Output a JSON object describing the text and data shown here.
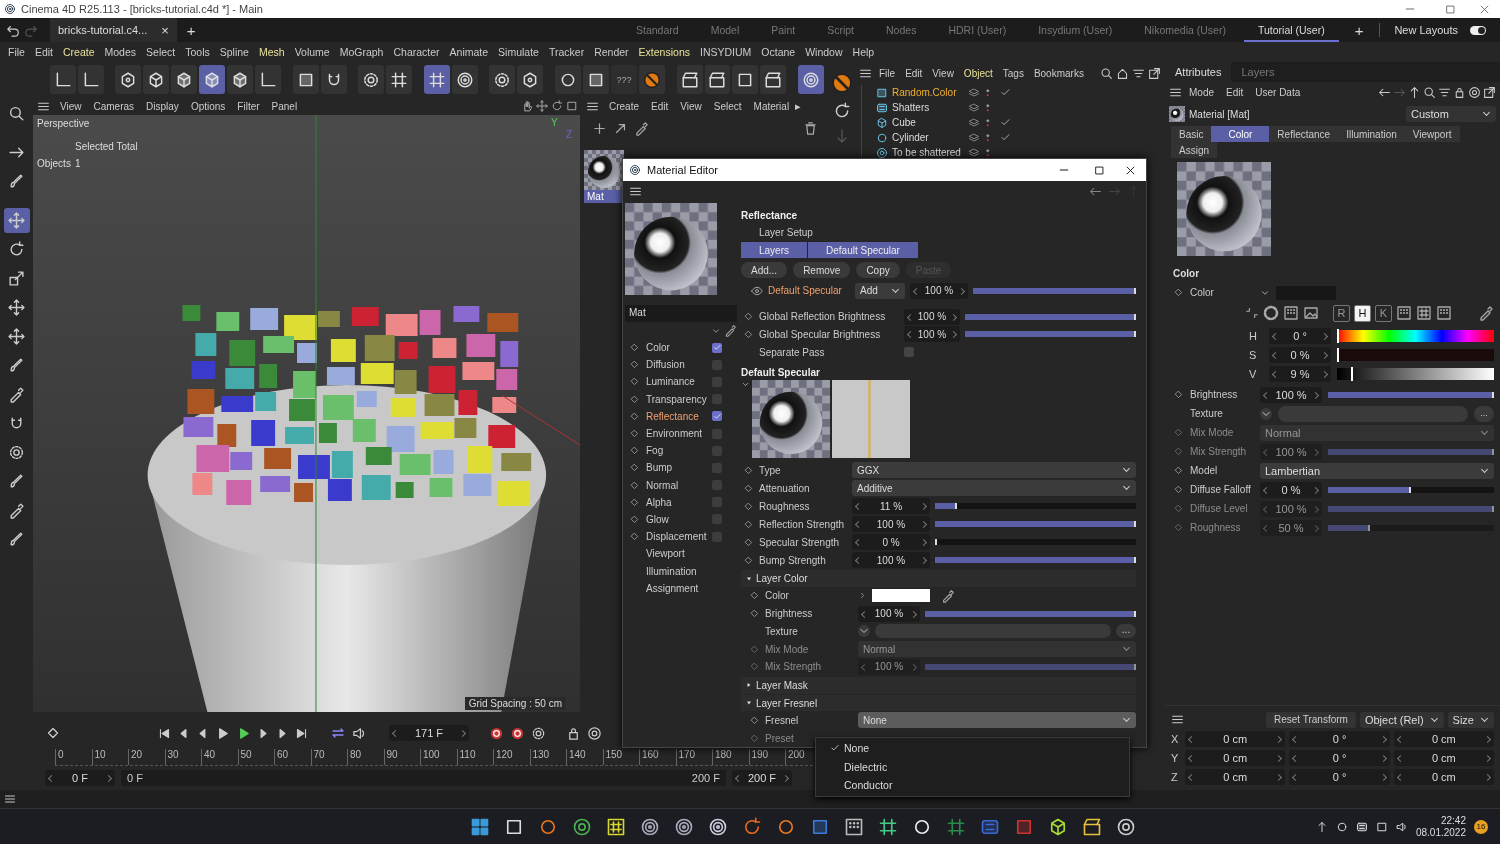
{
  "window": {
    "title": "Cinema 4D R25.113 - [bricks-tutorial.c4d *] - Main"
  },
  "document_tab": {
    "label": "bricks-tutorial.c4...",
    "close": "×"
  },
  "new_document": "+",
  "layouts": [
    {
      "label": "Standard",
      "selected": false
    },
    {
      "label": "Model",
      "selected": false
    },
    {
      "label": "Paint",
      "selected": false
    },
    {
      "label": "Script",
      "selected": false
    },
    {
      "label": "Nodes",
      "selected": false
    },
    {
      "label": "HDRI (User)",
      "selected": false
    },
    {
      "label": "Insydium (User)",
      "selected": false
    },
    {
      "label": "Nikomedia (User)",
      "selected": false
    },
    {
      "label": "Tutorial (User)",
      "selected": true
    }
  ],
  "add_layout": "+",
  "new_layouts": {
    "label": "New Layouts",
    "on": true
  },
  "menu": [
    {
      "label": "File",
      "highlighted": false
    },
    {
      "label": "Edit",
      "highlighted": false
    },
    {
      "label": "Create",
      "highlighted": true
    },
    {
      "label": "Modes",
      "highlighted": false
    },
    {
      "label": "Select",
      "highlighted": false
    },
    {
      "label": "Tools",
      "highlighted": false
    },
    {
      "label": "Spline",
      "highlighted": false
    },
    {
      "label": "Mesh",
      "highlighted": true
    },
    {
      "label": "Volume",
      "highlighted": false
    },
    {
      "label": "MoGraph",
      "highlighted": false
    },
    {
      "label": "Character",
      "highlighted": false
    },
    {
      "label": "Animate",
      "highlighted": false
    },
    {
      "label": "Simulate",
      "highlighted": false
    },
    {
      "label": "Tracker",
      "highlighted": false
    },
    {
      "label": "Render",
      "highlighted": false
    },
    {
      "label": "Extensions",
      "highlighted": true
    },
    {
      "label": "INSYDIUM",
      "highlighted": false
    },
    {
      "label": "Octane",
      "highlighted": false
    },
    {
      "label": "Window",
      "highlighted": false
    },
    {
      "label": "Help",
      "highlighted": false
    }
  ],
  "toolbar": {
    "tools": [
      {
        "active": false
      },
      {
        "active": false
      },
      {
        "active": false
      },
      {
        "active": false
      },
      {
        "active": false
      },
      {
        "active": true
      },
      {
        "active": false
      },
      {
        "active": false
      },
      {
        "active": false
      },
      {
        "active": false
      },
      {
        "active": false
      },
      {
        "active": false
      },
      {
        "active": true
      },
      {
        "active": false
      },
      {
        "active": false
      },
      {
        "active": false
      },
      {
        "active": false
      },
      {
        "active": false
      },
      {
        "active": false
      },
      {
        "active": false
      },
      {
        "active": false
      },
      {
        "active": false
      },
      {
        "active": false
      },
      {
        "active": true
      }
    ],
    "unknown_tool": "???"
  },
  "side_tools": [
    {
      "active": false
    },
    {
      "active": false
    },
    {
      "active": false
    },
    {
      "active": true
    },
    {
      "active": false
    },
    {
      "active": false
    },
    {
      "active": false
    },
    {
      "active": false
    },
    {
      "active": false
    },
    {
      "active": false
    },
    {
      "active": false
    },
    {
      "active": false
    },
    {
      "active": false
    },
    {
      "active": false
    },
    {
      "active": false
    }
  ],
  "viewport": {
    "menu": [
      "View",
      "Cameras",
      "Display",
      "Options",
      "Filter",
      "Panel"
    ],
    "camera": "Perspective",
    "hud_heading": "Selected Total",
    "hud_label": "Objects",
    "hud_value": "1",
    "axes": [
      "Y",
      "Z"
    ],
    "grid_spacing": "Grid Spacing : 50 cm"
  },
  "material_manager": {
    "menu": [
      "Create",
      "Edit",
      "View",
      "Select",
      "Material"
    ],
    "more": "▸",
    "materials": [
      {
        "name": "Mat",
        "selected": true
      }
    ]
  },
  "object_manager": {
    "menu": [
      {
        "label": "File",
        "highlighted": false
      },
      {
        "label": "Edit",
        "highlighted": false
      },
      {
        "label": "View",
        "highlighted": false
      },
      {
        "label": "Object",
        "highlighted": true
      },
      {
        "label": "Tags",
        "highlighted": false
      },
      {
        "label": "Bookmarks",
        "highlighted": false
      }
    ],
    "objects": [
      {
        "name": "Random.Color",
        "selected": true,
        "enabled": true
      },
      {
        "name": "Shatters",
        "selected": false,
        "enabled": false
      },
      {
        "name": "Cube",
        "selected": false,
        "enabled": true
      },
      {
        "name": "Cylinder",
        "selected": false,
        "enabled": true
      },
      {
        "name": "To be shattered",
        "selected": false,
        "enabled": false
      }
    ]
  },
  "attributes": {
    "tabs": [
      {
        "label": "Attributes",
        "selected": true
      },
      {
        "label": "Layers",
        "selected": false
      }
    ],
    "menu": [
      "Mode",
      "Edit",
      "User Data"
    ],
    "object": "Material [Mat]",
    "preset": "Custom",
    "sections": [
      {
        "label": "Basic",
        "selected": false
      },
      {
        "label": "Color",
        "selected": true
      },
      {
        "label": "Reflectance",
        "selected": false
      },
      {
        "label": "Illumination",
        "selected": false
      },
      {
        "label": "Viewport",
        "selected": false
      },
      {
        "label": "Assign",
        "selected": false
      }
    ],
    "heading": "Color",
    "color_label": "Color",
    "color_modes": [
      {
        "label": "R",
        "selected": false
      },
      {
        "label": "H",
        "selected": true
      },
      {
        "label": "K",
        "selected": false
      }
    ],
    "hsv": [
      {
        "label": "H",
        "value": "0 °",
        "level": 0
      },
      {
        "label": "S",
        "value": "0 %",
        "level": 0
      },
      {
        "label": "V",
        "value": "9 %",
        "level": 0.09
      }
    ],
    "params": [
      {
        "kind": "slider",
        "label": "Brightness",
        "value": "100 %",
        "level": 1,
        "disabled": false
      },
      {
        "kind": "texture",
        "label": "Texture",
        "more": "...",
        "disabled": false
      },
      {
        "kind": "dropdown",
        "label": "Mix Mode",
        "value": "Normal",
        "disabled": true
      },
      {
        "kind": "slider",
        "label": "Mix Strength",
        "value": "100 %",
        "level": 1,
        "disabled": true
      },
      {
        "kind": "dropdown",
        "label": "Model",
        "value": "Lambertian",
        "disabled": false
      },
      {
        "kind": "slider",
        "label": "Diffuse Falloff",
        "value": "0 %",
        "level": 0.5,
        "disabled": false
      },
      {
        "kind": "slider",
        "label": "Diffuse Level",
        "value": "100 %",
        "level": 1,
        "disabled": true
      },
      {
        "kind": "slider",
        "label": "Roughness",
        "value": "50 %",
        "level": 0.25,
        "disabled": true
      }
    ]
  },
  "coordinates": {
    "reset": "Reset Transform",
    "dropdowns": [
      "Object (Rel)",
      "Size"
    ],
    "rows": [
      {
        "axis": "X",
        "values": [
          "0 cm",
          "0 °",
          "0 cm"
        ]
      },
      {
        "axis": "Y",
        "values": [
          "0 cm",
          "0 °",
          "0 cm"
        ]
      },
      {
        "axis": "Z",
        "values": [
          "0 cm",
          "0 °",
          "0 cm"
        ]
      }
    ]
  },
  "timeline": {
    "current_frame": "171 F",
    "ruler": [
      "0",
      "10",
      "20",
      "30",
      "40",
      "50",
      "60",
      "70",
      "80",
      "90",
      "100",
      "110",
      "120",
      "130",
      "140",
      "150",
      "160",
      "170",
      "180",
      "190",
      "200"
    ],
    "start": "0 F",
    "range_start": "0 F",
    "range_end": "200 F",
    "end": "200 F"
  },
  "material_editor": {
    "title": "Material Editor",
    "name": "Mat",
    "channels": [
      {
        "label": "Color",
        "kind": "channel",
        "checked": true,
        "selected": false
      },
      {
        "label": "Diffusion",
        "kind": "channel",
        "checked": false,
        "selected": false
      },
      {
        "label": "Luminance",
        "kind": "channel",
        "checked": false,
        "selected": false
      },
      {
        "label": "Transparency",
        "kind": "channel",
        "checked": false,
        "selected": false
      },
      {
        "label": "Reflectance",
        "kind": "channel",
        "checked": true,
        "selected": true
      },
      {
        "label": "Environment",
        "kind": "channel",
        "checked": false,
        "selected": false
      },
      {
        "label": "Fog",
        "kind": "channel",
        "checked": false,
        "selected": false
      },
      {
        "label": "Bump",
        "kind": "channel",
        "checked": false,
        "selected": false
      },
      {
        "label": "Normal",
        "kind": "channel",
        "checked": false,
        "selected": false
      },
      {
        "label": "Alpha",
        "kind": "channel",
        "checked": false,
        "selected": false
      },
      {
        "label": "Glow",
        "kind": "channel",
        "checked": false,
        "selected": false
      },
      {
        "label": "Displacement",
        "kind": "channel",
        "checked": false,
        "selected": false
      },
      {
        "label": "Viewport",
        "kind": "page",
        "selected": false
      },
      {
        "label": "Illumination",
        "kind": "page",
        "selected": false
      },
      {
        "label": "Assignment",
        "kind": "page",
        "selected": false
      }
    ],
    "heading": "Reflectance",
    "layer_setup": "Layer Setup",
    "layer_tabs": [
      {
        "label": "Layers",
        "selected": true
      },
      {
        "label": "Default Specular",
        "selected": true
      }
    ],
    "layer_buttons": [
      {
        "label": "Add...",
        "disabled": false
      },
      {
        "label": "Remove",
        "disabled": false
      },
      {
        "label": "Copy",
        "disabled": false
      },
      {
        "label": "Paste",
        "disabled": true
      }
    ],
    "layer": {
      "name": "Default Specular",
      "mode": "Add",
      "value": "100 %",
      "level": 1
    },
    "globals": [
      {
        "label": "Global Reflection Brightness",
        "value": "100 %",
        "level": 1
      },
      {
        "label": "Global Specular Brightness",
        "value": "100 %",
        "level": 1
      }
    ],
    "separate_pass": {
      "label": "Separate Pass",
      "checked": false
    },
    "layer_heading": "Default Specular",
    "params": [
      {
        "kind": "dropdown",
        "label": "Type",
        "value": "GGX"
      },
      {
        "kind": "dropdown",
        "label": "Attenuation",
        "value": "Additive"
      },
      {
        "kind": "slider",
        "label": "Roughness",
        "value": "11 %",
        "level": 0.11
      },
      {
        "kind": "slider",
        "label": "Reflection Strength",
        "value": "100 %",
        "level": 1
      },
      {
        "kind": "slider",
        "label": "Specular Strength",
        "value": "0 %",
        "level": 0
      },
      {
        "kind": "slider",
        "label": "Bump Strength",
        "value": "100 %",
        "level": 1
      }
    ],
    "groups": [
      {
        "title": "Layer Color",
        "expanded": true,
        "params": [
          {
            "kind": "color",
            "label": "Color"
          },
          {
            "kind": "slider",
            "label": "Brightness",
            "value": "100 %",
            "level": 1
          },
          {
            "kind": "texture",
            "label": "Texture",
            "more": "..."
          },
          {
            "kind": "dropdown",
            "label": "Mix Mode",
            "value": "Normal",
            "disabled": true
          },
          {
            "kind": "slider",
            "label": "Mix Strength",
            "value": "100 %",
            "level": 1,
            "disabled": true
          }
        ]
      },
      {
        "title": "Layer Mask",
        "expanded": false
      },
      {
        "title": "Layer Fresnel",
        "expanded": true,
        "params": [
          {
            "kind": "dropdown",
            "label": "Fresnel",
            "value": "None",
            "open": true
          },
          {
            "kind": "label",
            "label": "Preset",
            "disabled": true
          }
        ]
      }
    ]
  },
  "fresnel_menu": [
    {
      "label": "None",
      "selected": true
    },
    {
      "label": "Dielectric",
      "selected": false
    },
    {
      "label": "Conductor",
      "selected": false
    }
  ],
  "clock": {
    "time": "22:42",
    "date": "08.01.2022",
    "notifications": "16"
  }
}
